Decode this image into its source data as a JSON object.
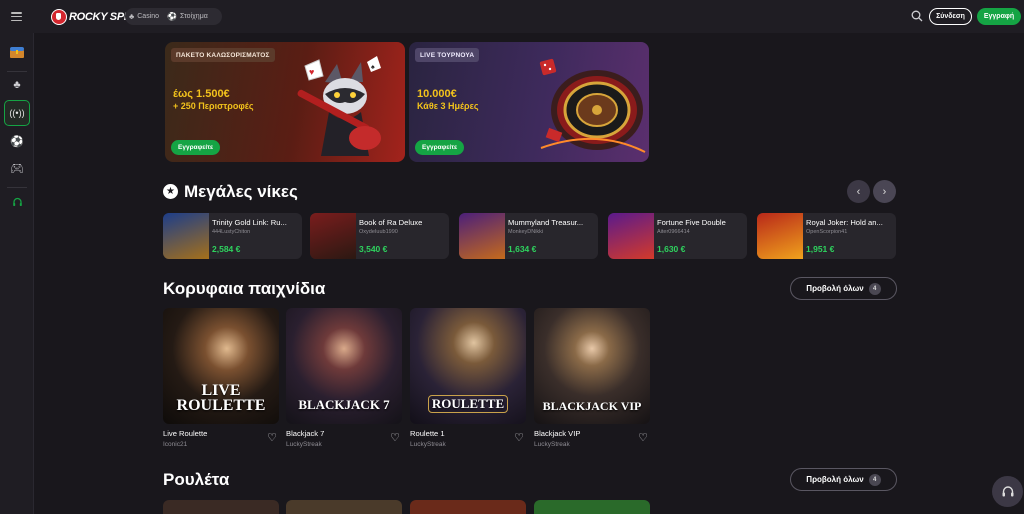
{
  "header": {
    "brand": "ROCKY SPIN",
    "nav": [
      {
        "label": "Casino",
        "icon": "cherries-icon"
      },
      {
        "label": "Στοίχημα",
        "icon": "ball-icon"
      }
    ],
    "login": "Σύνδεση",
    "register": "Εγγραφή"
  },
  "sidebar": {
    "items": [
      {
        "name": "treasure-chest",
        "icon": "chest-icon"
      },
      {
        "name": "cherries",
        "icon": "cherries-icon"
      },
      {
        "name": "live",
        "icon": "broadcast-icon"
      },
      {
        "name": "sports",
        "icon": "soccer-ball-icon"
      },
      {
        "name": "gaming",
        "icon": "gamepad-icon"
      },
      {
        "name": "support",
        "icon": "headset-icon"
      }
    ]
  },
  "banners": [
    {
      "tag": "ΠΑΚΕΤΟ ΚΑΛΩΣΟΡΙΣΜΑΤΟΣ",
      "line1": "έως 1.500€",
      "line2": "+ 250 Περιστροφές",
      "cta": "Εγγραφείτε"
    },
    {
      "tag": "LIVE ΤΟΥΡΝΟΥΑ",
      "line1": "10.000€",
      "line2": "Κάθε 3 Ημέρες",
      "cta": "Εγγραφείτε"
    }
  ],
  "big_wins": {
    "title": "Μεγάλες νίκες",
    "items": [
      {
        "title": "Trinity Gold Link: Ru...",
        "user": "444LustyChiton",
        "amount": "2,584 €"
      },
      {
        "title": "Book of Ra Deluxe",
        "user": "OxydeIuub1990",
        "amount": "3,540 €"
      },
      {
        "title": "Mummyland Treasur...",
        "user": "MonkeyDNikki",
        "amount": "1,634 €"
      },
      {
        "title": "Fortune Five Double",
        "user": "Aiter0966414",
        "amount": "1,630 €"
      },
      {
        "title": "Royal Joker: Hold an...",
        "user": "OpenScorpion41",
        "amount": "1,951 €"
      }
    ]
  },
  "top_games": {
    "title": "Κορυφαια παιχνίδια",
    "view_all": "Προβολή όλων",
    "count": "4",
    "items": [
      {
        "name": "Live Roulette",
        "provider": "Iconic21",
        "art": "LIVE ROULETTE"
      },
      {
        "name": "Blackjack 7",
        "provider": "LuckyStreak",
        "art": "BLACKJACK 7"
      },
      {
        "name": "Roulette 1",
        "provider": "LuckyStreak",
        "art": "ROULETTE"
      },
      {
        "name": "Blackjack VIP",
        "provider": "LuckyStreak",
        "art": "BLACKJACK VIP"
      }
    ]
  },
  "roulette": {
    "title": "Ρουλέτα",
    "view_all": "Προβολή όλων",
    "count": "4"
  },
  "colors": {
    "accent": "#15a444",
    "win_amount": "#2ed35e",
    "banner_text": "#f2c21c"
  }
}
